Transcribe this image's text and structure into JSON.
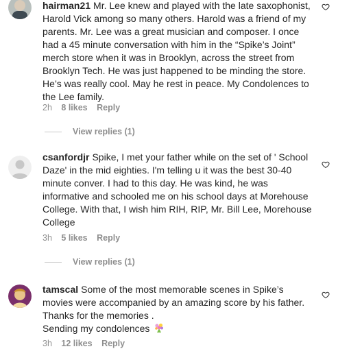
{
  "comments": [
    {
      "username": "hairman21",
      "text": "Mr. Lee knew and played with the late saxophonist, Harold Vick among so many others. Harold was a friend of my parents. Mr. Lee was a great musician and composer. I once had a 45 minute conversation with him in the “Spike’s Joint” merch store when it was in Brooklyn, across the street from Brooklyn Tech. He was just happened to be minding the store. He’s was really cool. May he rest in peace. My Condolences to the Lee family.",
      "time": "2h",
      "likes": "8 likes",
      "reply": "Reply",
      "view_replies": "View replies (1)"
    },
    {
      "username": "csanfordjr",
      "text": "Spike, I met your father while on the set of ' School Daze' in the mid eighties. I'm telling u it was the best 30-40 minute conver. I had to this day. He was kind, he was informative and schooled me on his school days at Morehouse College. With that, I wish him RIH, RIP, Mr. Bill Lee, Morehouse College",
      "time": "3h",
      "likes": "5 likes",
      "reply": "Reply",
      "view_replies": "View replies (1)"
    },
    {
      "username": "tamscal",
      "text": "Some of the most memorable scenes in Spike’s movies were accompanied by an amazing score by his father. Thanks for the memories .",
      "text_line2": "Sending my condolences",
      "emoji": "bouquet-emoji",
      "time": "3h",
      "likes": "12 likes",
      "reply": "Reply"
    }
  ],
  "colors": {
    "text": "#262626",
    "meta": "#8e8e8e",
    "divider": "#c7c7c7"
  },
  "icons": {
    "like": "heart-outline-icon"
  }
}
